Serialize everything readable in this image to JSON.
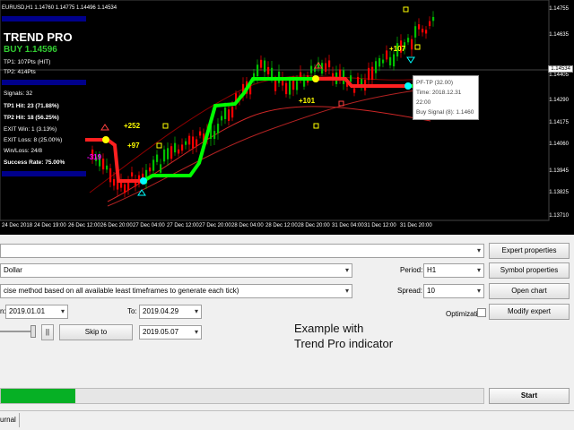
{
  "chart": {
    "title": "EURUSD,H1  1.14760  1.14775  1.14496  1.14534",
    "panel": {
      "name": "TREND PRO",
      "signal": "BUY 1.14596",
      "tp1": "TP1: 107Pts (HIT)",
      "tp2": "TP2: 414Pts",
      "signals": "Signals: 32",
      "tp1_hit": "TP1 Hit: 23 (71.88%)",
      "tp2_hit": "TP2 Hit: 18 (56.25%)",
      "exit_win": "EXIT Win: 1 (3.13%)",
      "exit_loss": "EXIT Loss: 8 (25.00%)",
      "win_loss": "Win/Loss: 24/8",
      "success": "Success Rate: 75.00%"
    },
    "y_ticks": [
      "1.14755",
      "1.14635",
      "1.14405",
      "1.14290",
      "1.14175",
      "1.14060",
      "1.13945",
      "1.13825",
      "1.13710"
    ],
    "price_box": "1.14534",
    "x_ticks": [
      "24 Dec 2018",
      "24 Dec 19:00",
      "26 Dec 12:00",
      "26 Dec 20:00",
      "27 Dec 04:00",
      "27 Dec 12:00",
      "27 Dec 20:00",
      "28 Dec 04:00",
      "28 Dec 12:00",
      "28 Dec 20:00",
      "31 Dec 04:00",
      "31 Dec 12:00",
      "31 Dec 20:00"
    ],
    "annotations": {
      "p252": "+252",
      "p97": "+97",
      "m319": "-319",
      "p101": "+101",
      "p107": "+107"
    },
    "tooltip": {
      "line1": "PF-TP (32.00)",
      "line2": "Time: 2018.12.31 22:00",
      "line3": "Buy Signal (8): 1.1460"
    },
    "colors": {
      "uptrend": "#00ff00",
      "downtrend": "#ff2020",
      "candle_up": "#00c000",
      "candle_down": "#ff0000"
    }
  },
  "tester": {
    "expert_value": "",
    "symbol_value": "Dollar",
    "model_value": "cise method based on all available least timeframes to generate each tick)",
    "period_label": "Period:",
    "period_value": "H1",
    "spread_label": "Spread:",
    "spread_value": "10",
    "from_label": "n:",
    "from_value": "2019.01.01",
    "to_label": "To:",
    "to_value": "2019.04.29",
    "pause_label": "||",
    "skip_label": "Skip to",
    "skip_value": "2019.05.07",
    "optimization_label": "Optimization",
    "buttons": {
      "expert_properties": "Expert properties",
      "symbol_properties": "Symbol properties",
      "open_chart": "Open chart",
      "modify_expert": "Modify expert",
      "start": "Start"
    },
    "caption_line1": "Example with",
    "caption_line2": "Trend Pro indicator",
    "progress": 0.155,
    "status_tab": "urnal"
  }
}
